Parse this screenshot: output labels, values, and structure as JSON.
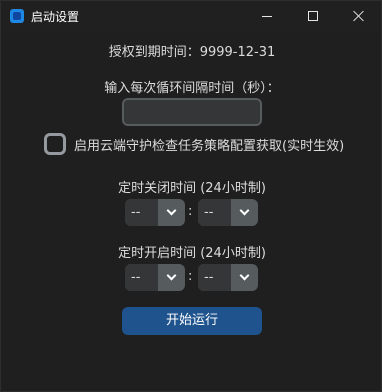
{
  "window": {
    "title": "启动设置",
    "icon": "app-icon",
    "controls": [
      "minimize-icon",
      "maximize-icon",
      "close-icon"
    ]
  },
  "expiry": {
    "text": "授权到期时间：9999-12-31"
  },
  "interval": {
    "label": "输入每次循环间隔时间（秒）：",
    "value": "",
    "placeholder": ""
  },
  "cloud_guard": {
    "label": "启用云端守护检查任务策略配置获取(实时生效)",
    "checked": false
  },
  "close_time": {
    "label": "定时关闭时间 (24小时制)",
    "hour": "--",
    "minute": "--",
    "separator": ":"
  },
  "open_time": {
    "label": "定时开启时间 (24小时制)",
    "hour": "--",
    "minute": "--",
    "separator": ":"
  },
  "start_button": {
    "label": "开始运行"
  },
  "colors": {
    "background": "#1f1f1f",
    "input_bg": "#343638",
    "border": "#565b5e",
    "button": "#1f538d",
    "text": "#dcdcdc"
  }
}
